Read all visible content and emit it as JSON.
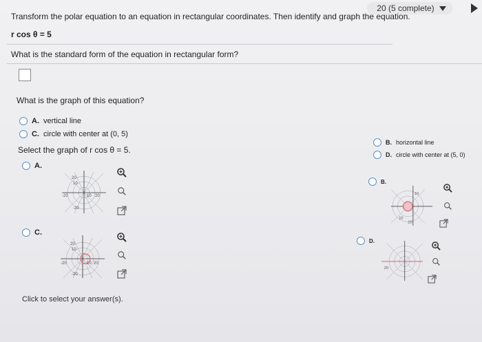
{
  "header": {
    "progress_text": "20 (5 complete)",
    "dropdown_icon": "caret-down-icon",
    "next_icon": "play-right-icon"
  },
  "question": {
    "instruction": "Transform the polar equation to an equation in rectangular coordinates. Then identify and graph the equation.",
    "equation": "r cos θ = 5",
    "standard_form_prompt": "What is the standard form of the equation in rectangular form?",
    "answer_value": "",
    "graph_type_prompt": "What is the graph of this equation?"
  },
  "graph_type_options": [
    {
      "letter": "A.",
      "text": "vertical line"
    },
    {
      "letter": "B.",
      "text": "horizontal line"
    },
    {
      "letter": "C.",
      "text": "circle with center at (0, 5)"
    },
    {
      "letter": "D.",
      "text": "circle with center at (5, 0)"
    }
  ],
  "graph_select": {
    "prompt": "Select the graph of r cos θ = 5.",
    "options": [
      {
        "letter": "A.",
        "tick_labels": [
          "20",
          "10",
          "-20",
          "10",
          "20",
          "-20"
        ]
      },
      {
        "letter": "B.",
        "tick_labels": [
          "10",
          "10",
          "20"
        ]
      },
      {
        "letter": "C.",
        "tick_labels": [
          "20",
          "10",
          "-20",
          "10",
          "20",
          "-20"
        ]
      },
      {
        "letter": "D.",
        "tick_labels": [
          "20"
        ]
      }
    ]
  },
  "tools": {
    "zoom_in": "zoom-in-icon",
    "zoom_out": "zoom-out-icon",
    "expand": "expand-icon"
  },
  "footer": {
    "text": "Click to select your answer(s)."
  },
  "colors": {
    "accent": "#5a8fc8",
    "graph_curve": "#e0707a",
    "grid": "#9aa0a6"
  }
}
